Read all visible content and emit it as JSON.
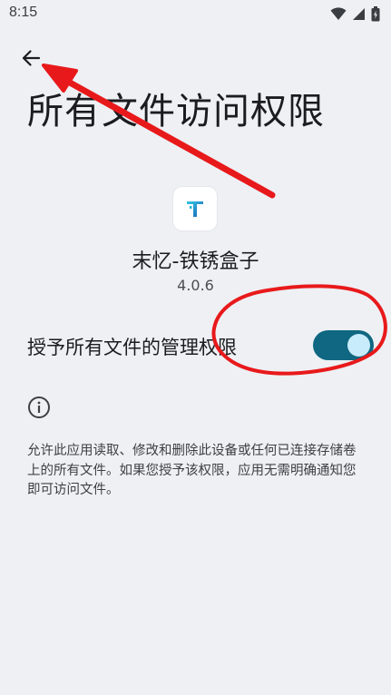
{
  "status_bar": {
    "time": "8:15",
    "icons": [
      "wifi-icon",
      "signal-icon",
      "battery-icon"
    ]
  },
  "header": {
    "back_icon": "arrow-left-icon",
    "title": "所有文件访问权限"
  },
  "app": {
    "icon": "app-logo-icon",
    "name": "末忆-铁锈盒子",
    "version": "4.0.6"
  },
  "permission": {
    "label": "授予所有文件的管理权限",
    "enabled": true
  },
  "info": {
    "icon": "info-icon",
    "description": "允许此应用读取、修改和删除此设备或任何已连接存储卷上的所有文件。如果您授予该权限，应用无需明确通知您即可访问文件。"
  },
  "colors": {
    "background": "#eef0f4",
    "switch_track": "#0f6781",
    "switch_thumb": "#c8ecfb",
    "annotation": "#e8191b"
  }
}
